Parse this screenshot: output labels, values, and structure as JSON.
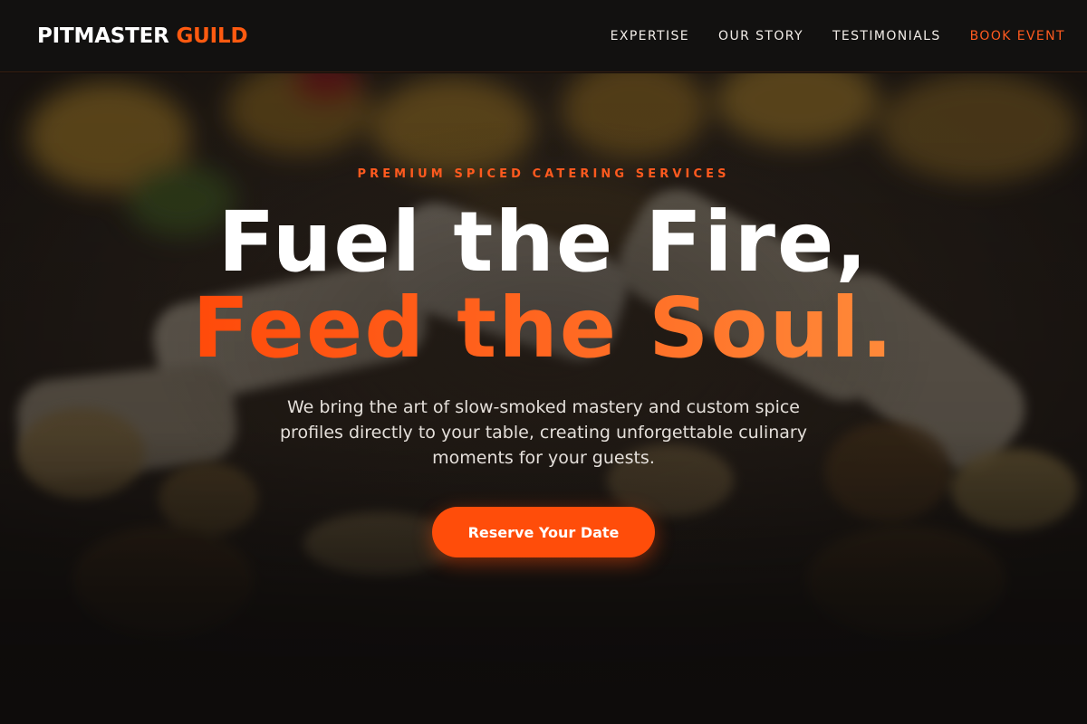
{
  "brand": {
    "word1": "PITMASTER",
    "word2": "GUILD"
  },
  "nav": {
    "items": [
      {
        "label": "EXPERTISE"
      },
      {
        "label": "OUR STORY"
      },
      {
        "label": "TESTIMONIALS"
      },
      {
        "label": "BOOK EVENT"
      }
    ]
  },
  "hero": {
    "eyebrow": "PREMIUM SPICED CATERING SERVICES",
    "headline_line1": "Fuel the Fire,",
    "headline_line2": "Feed the Soul.",
    "description": "We bring the art of slow-smoked mastery and custom spice profiles directly to your table, creating unforgettable culinary moments for your guests.",
    "cta_label": "Reserve Your Date",
    "background_image": "food-platter-photo"
  },
  "colors": {
    "accent": "#ff5a1f",
    "cta": "#ff4d0a",
    "header_bg": "#121110",
    "page_bg": "#0e0c0b"
  }
}
